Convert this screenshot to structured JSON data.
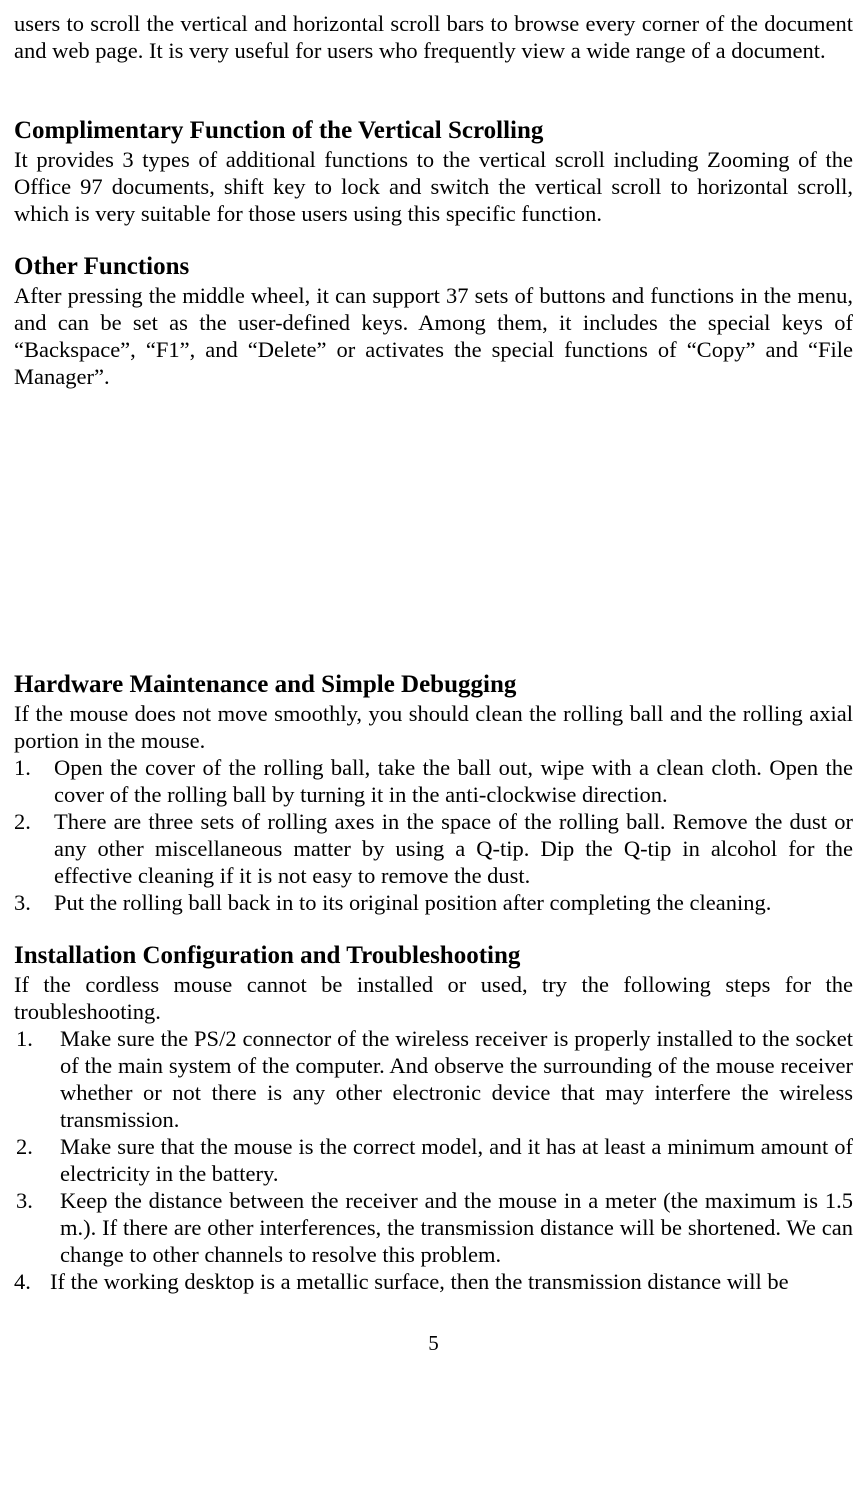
{
  "intro_paragraph": "users to scroll the vertical and horizontal scroll bars to browse every corner of the document and web page.  It is very useful for users who frequently view a wide range of a document.",
  "section1": {
    "heading": "Complimentary Function of the Vertical Scrolling",
    "paragraph": "It provides 3 types of additional functions to the vertical scroll including Zooming of the Office 97 documents, shift key to lock and switch the vertical scroll to horizontal scroll, which is very suitable for those users using this specific function."
  },
  "section2": {
    "heading": "Other Functions",
    "paragraph": "After pressing the middle wheel, it can support 37 sets of buttons and functions in the menu, and can be set as the user-defined keys.  Among them, it includes the special keys of “Backspace”, “F1”, and “Delete” or activates the special functions of “Copy” and “File Manager”."
  },
  "section3": {
    "heading": "Hardware Maintenance and Simple Debugging",
    "paragraph": "If the mouse does not move smoothly, you should clean the rolling ball and the rolling axial portion in the mouse.",
    "items": [
      {
        "num": "1.",
        "text": "Open the cover of the rolling ball, take the ball out, wipe with a clean cloth.  Open the cover of the rolling ball by turning it in the anti-clockwise direction."
      },
      {
        "num": "2.",
        "text": "There are three sets of rolling axes in the space of the rolling ball.  Remove the dust or any other miscellaneous matter by using a Q-tip.  Dip the Q-tip in alcohol for the effective cleaning if it is not easy to remove the dust."
      },
      {
        "num": "3.",
        "text": "Put the rolling ball back in to its original position after completing the cleaning."
      }
    ]
  },
  "section4": {
    "heading": "Installation Configuration and Troubleshooting",
    "paragraph": "If the cordless mouse cannot be installed or used, try the following steps for the troubleshooting.",
    "items": [
      {
        "num": "1.",
        "text": "Make sure the PS/2 connector of the wireless receiver is properly installed to the socket of the main system of the computer.  And observe the surrounding of the mouse receiver whether or not there is any other electronic device that may interfere the wireless transmission."
      },
      {
        "num": "2.",
        "text": "Make sure that the mouse is the correct model, and it has at least a minimum amount of electricity in the battery."
      },
      {
        "num": "3.",
        "text": "Keep the distance between the receiver and the mouse in a meter (the maximum is 1.5 m.).  If there are other interferences, the transmission distance will be shortened. We can change to other channels to resolve this problem."
      }
    ],
    "item4": {
      "num": "4.",
      "text": "If the working desktop is a metallic surface, then the transmission distance will be"
    }
  },
  "page_number": "5"
}
